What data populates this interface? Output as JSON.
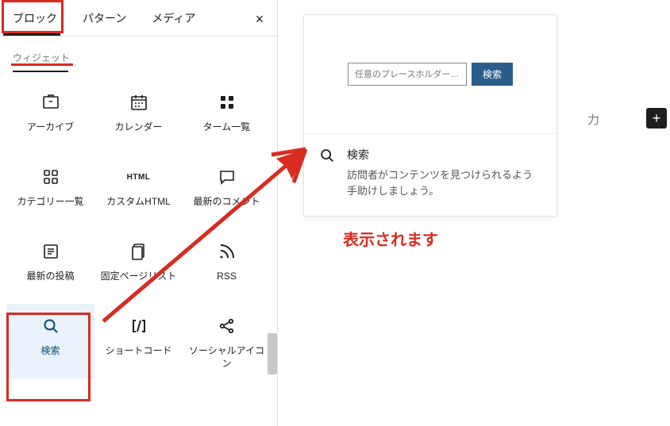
{
  "tabs": {
    "blocks": "ブロック",
    "patterns": "パターン",
    "media": "メディア"
  },
  "close_glyph": "×",
  "category_label": "ウィジェット",
  "blocks": [
    {
      "key": "archive",
      "label": "アーカイブ"
    },
    {
      "key": "calendar",
      "label": "カレンダー"
    },
    {
      "key": "tag-cloud",
      "label": "ターム一覧"
    },
    {
      "key": "categories",
      "label": "カテゴリー一覧"
    },
    {
      "key": "custom-html",
      "label": "カスタムHTML"
    },
    {
      "key": "latest-comments",
      "label": "最新のコメント"
    },
    {
      "key": "latest-posts",
      "label": "最新の投稿"
    },
    {
      "key": "page-list",
      "label": "固定ページリスト"
    },
    {
      "key": "rss",
      "label": "RSS"
    },
    {
      "key": "search",
      "label": "検索"
    },
    {
      "key": "shortcode",
      "label": "ショートコード"
    },
    {
      "key": "social-icons",
      "label": "ソーシャルアイコン"
    }
  ],
  "preview": {
    "placeholder": "任意のプレースホルダー…",
    "button": "検索",
    "title": "検索",
    "description": "訪問者がコンテンツを見つけられるよう手助けしましょう。"
  },
  "annotation_text": "表示されます",
  "stray": "力",
  "add_glyph": "+",
  "html_badge": "HTML"
}
